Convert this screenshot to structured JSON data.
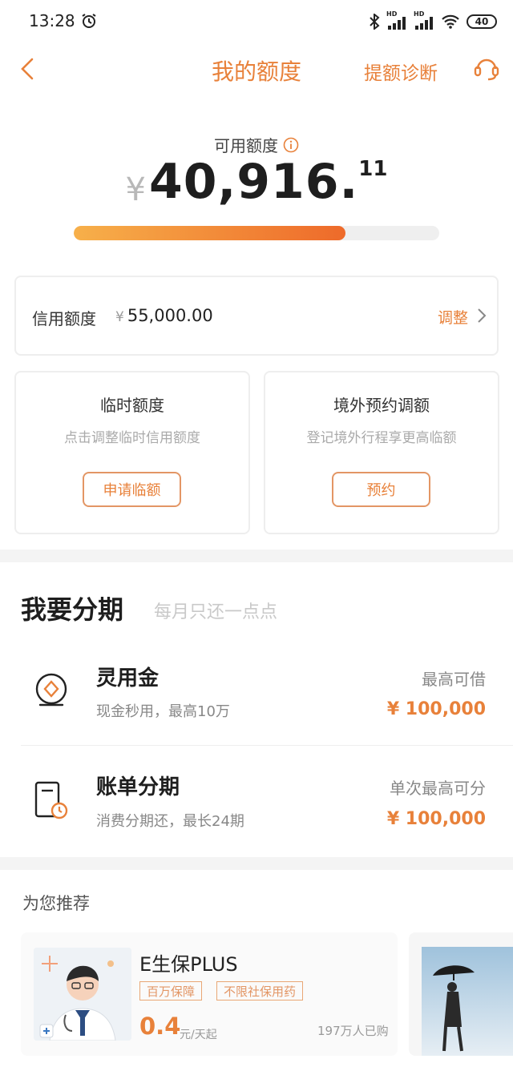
{
  "status_bar": {
    "time": "13:28",
    "battery": "40",
    "network_labels": [
      "HD",
      "HD"
    ]
  },
  "header": {
    "title": "我的额度",
    "diagnose_label": "提额诊断"
  },
  "available": {
    "label": "可用额度",
    "currency": "¥",
    "amount_int": "40,916.",
    "amount_dec": "11",
    "progress_fraction": 0.744
  },
  "credit": {
    "label": "信用额度",
    "currency": "¥",
    "value": "55,000.00",
    "adjust_label": "调整"
  },
  "temp_limit": {
    "title": "临时额度",
    "subtitle": "点击调整临时信用额度",
    "button": "申请临额"
  },
  "overseas": {
    "title": "境外预约调额",
    "subtitle": "登记境外行程享更高临额",
    "button": "预约"
  },
  "installment": {
    "title": "我要分期",
    "subtitle": "每月只还一点点",
    "items": [
      {
        "title": "灵用金",
        "subtitle": "现金秒用，最高10万",
        "right_label": "最高可借",
        "right_value": "¥ 100,000",
        "icon": "cash-icon"
      },
      {
        "title": "账单分期",
        "subtitle": "消费分期还，最长24期",
        "right_label": "单次最高可分",
        "right_value": "¥ 100,000",
        "icon": "bill-clock-icon"
      }
    ]
  },
  "recommend": {
    "title": "为您推荐",
    "product": {
      "name": "E生保PLUS",
      "tags": [
        "百万保障",
        "不限社保用药"
      ],
      "price": "0.4",
      "price_unit": "元/天起",
      "buyers": "197万人已购"
    }
  },
  "colors": {
    "accent": "#e8813a",
    "bar_start": "#f7b04a",
    "bar_end": "#ee6a2a"
  }
}
